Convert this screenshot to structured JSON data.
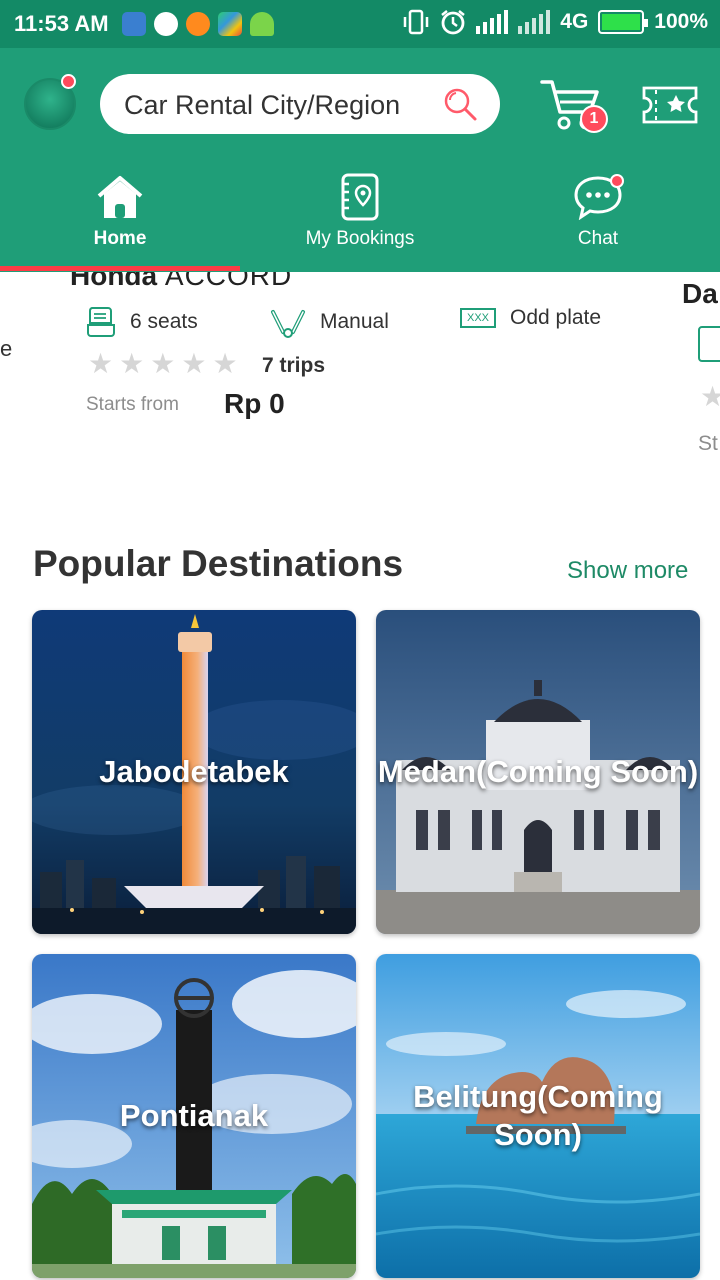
{
  "status_bar": {
    "time": "11:53 AM",
    "network": "4G",
    "battery": "100%"
  },
  "header": {
    "search_placeholder": "Car Rental City/Region",
    "cart_count": "1"
  },
  "nav": {
    "tabs": [
      {
        "label": "Home",
        "icon": "home-icon",
        "active": true
      },
      {
        "label": "My Bookings",
        "icon": "bookings-icon",
        "active": false
      },
      {
        "label": "Chat",
        "icon": "chat-icon",
        "active": false
      }
    ]
  },
  "car": {
    "brand": "Honda",
    "model": "ACCORD",
    "seats": "6 seats",
    "transmission": "Manual",
    "plate": "Odd plate",
    "plate_icon_text": "XXX",
    "rating": 0,
    "trips": "7 trips",
    "starts_from": "Starts from",
    "price": "Rp 0"
  },
  "next_car": {
    "title_fragment": "Da",
    "starts_fragment": "St"
  },
  "prev_car": {
    "fragment": "e"
  },
  "destinations": {
    "title": "Popular Destinations",
    "show_more": "Show more",
    "items": [
      {
        "name": "Jabodetabek"
      },
      {
        "name": "Medan(Coming Soon)"
      },
      {
        "name": "Pontianak"
      },
      {
        "name": "Belitung(Coming Soon)"
      }
    ]
  },
  "colors": {
    "brand_green": "#1f9e78",
    "status_green": "#138a66",
    "badge_red": "#ff4b5c",
    "active_underline": "#ff3b45",
    "link_green": "#1e8a66"
  }
}
